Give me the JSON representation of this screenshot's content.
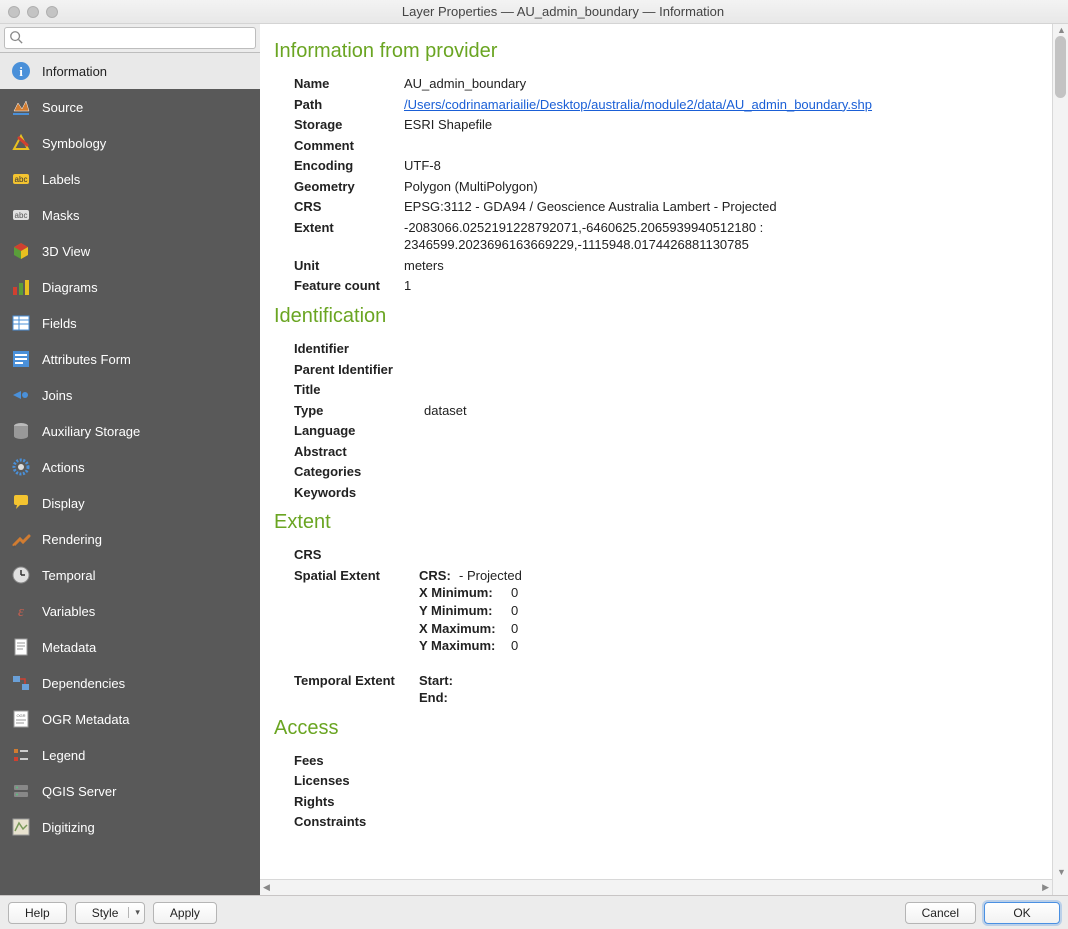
{
  "window": {
    "title": "Layer Properties — AU_admin_boundary — Information"
  },
  "search": {
    "placeholder": ""
  },
  "sidebar": {
    "items": [
      {
        "label": "Information"
      },
      {
        "label": "Source"
      },
      {
        "label": "Symbology"
      },
      {
        "label": "Labels"
      },
      {
        "label": "Masks"
      },
      {
        "label": "3D View"
      },
      {
        "label": "Diagrams"
      },
      {
        "label": "Fields"
      },
      {
        "label": "Attributes Form"
      },
      {
        "label": "Joins"
      },
      {
        "label": "Auxiliary Storage"
      },
      {
        "label": "Actions"
      },
      {
        "label": "Display"
      },
      {
        "label": "Rendering"
      },
      {
        "label": "Temporal"
      },
      {
        "label": "Variables"
      },
      {
        "label": "Metadata"
      },
      {
        "label": "Dependencies"
      },
      {
        "label": "OGR Metadata"
      },
      {
        "label": "Legend"
      },
      {
        "label": "QGIS Server"
      },
      {
        "label": "Digitizing"
      }
    ]
  },
  "sections": {
    "provider": {
      "heading": "Information from provider",
      "name_label": "Name",
      "name_value": "AU_admin_boundary",
      "path_label": "Path",
      "path_value": "/Users/codrinamariailie/Desktop/australia/module2/data/AU_admin_boundary.shp",
      "storage_label": "Storage",
      "storage_value": "ESRI Shapefile",
      "comment_label": "Comment",
      "comment_value": "",
      "encoding_label": "Encoding",
      "encoding_value": "UTF-8",
      "geometry_label": "Geometry",
      "geometry_value": "Polygon (MultiPolygon)",
      "crs_label": "CRS",
      "crs_value": "EPSG:3112 - GDA94 / Geoscience Australia Lambert - Projected",
      "extent_label": "Extent",
      "extent_value": "-2083066.0252191228792071,-6460625.2065939940512180 : 2346599.2023696163669229,-1115948.0174426881130785",
      "unit_label": "Unit",
      "unit_value": "meters",
      "count_label": "Feature count",
      "count_value": "1"
    },
    "identification": {
      "heading": "Identification",
      "identifier_label": "Identifier",
      "parent_label": "Parent Identifier",
      "title_label": "Title",
      "type_label": "Type",
      "type_value": "dataset",
      "language_label": "Language",
      "abstract_label": "Abstract",
      "categories_label": "Categories",
      "keywords_label": "Keywords"
    },
    "extent": {
      "heading": "Extent",
      "crs_label": "CRS",
      "spatial_label": "Spatial Extent",
      "spatial_crs_k": "CRS:",
      "spatial_crs_v": " - Projected",
      "xmin_k": "X Minimum:",
      "xmin_v": " 0",
      "ymin_k": "Y Minimum:",
      "ymin_v": " 0",
      "xmax_k": "X Maximum:",
      "xmax_v": " 0",
      "ymax_k": "Y Maximum:",
      "ymax_v": " 0",
      "temporal_label": "Temporal Extent",
      "start_k": "Start:",
      "end_k": "End:"
    },
    "access": {
      "heading": "Access",
      "fees_label": "Fees",
      "licenses_label": "Licenses",
      "rights_label": "Rights",
      "constraints_label": "Constraints"
    }
  },
  "buttons": {
    "help": "Help",
    "style": "Style",
    "apply": "Apply",
    "cancel": "Cancel",
    "ok": "OK"
  }
}
